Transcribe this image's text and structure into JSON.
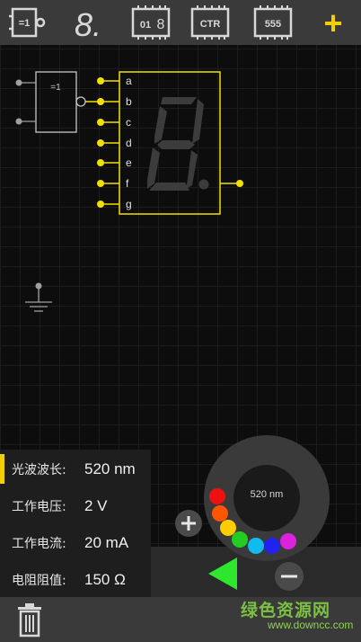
{
  "toolbar": {
    "items": [
      {
        "name": "xor-gate-tool",
        "label": "=1"
      },
      {
        "name": "seven-segment-tool",
        "label": "8."
      },
      {
        "name": "counter-display-tool",
        "label": "01"
      },
      {
        "name": "ctr-tool",
        "label": "CTR"
      },
      {
        "name": "timer-555-tool",
        "label": "555"
      },
      {
        "name": "add-tool",
        "label": "+"
      }
    ],
    "accent_color": "#f2d000"
  },
  "circuit": {
    "gate_label": "=1",
    "segment_pins": [
      "a",
      "b",
      "c",
      "d",
      "e",
      "f",
      "g"
    ],
    "wire_color": "#f2e000",
    "display_digit_color": "#3a3a3a"
  },
  "params": {
    "rows": [
      {
        "label": "光波波长:",
        "value": "520 nm",
        "active": true
      },
      {
        "label": "工作电压:",
        "value": "2 V",
        "active": false
      },
      {
        "label": "工作电流:",
        "value": "20 mA",
        "active": false
      },
      {
        "label": "电阻阻值:",
        "value": "150 Ω",
        "active": false
      }
    ]
  },
  "dial": {
    "readout": "520 nm",
    "colors": [
      "#ee1111",
      "#ff5500",
      "#ffcc00",
      "#22cc22",
      "#11bbee",
      "#2222ee",
      "#dd22dd"
    ]
  },
  "watermark": {
    "title": "绿色资源网",
    "url": "www.downcc.com"
  }
}
